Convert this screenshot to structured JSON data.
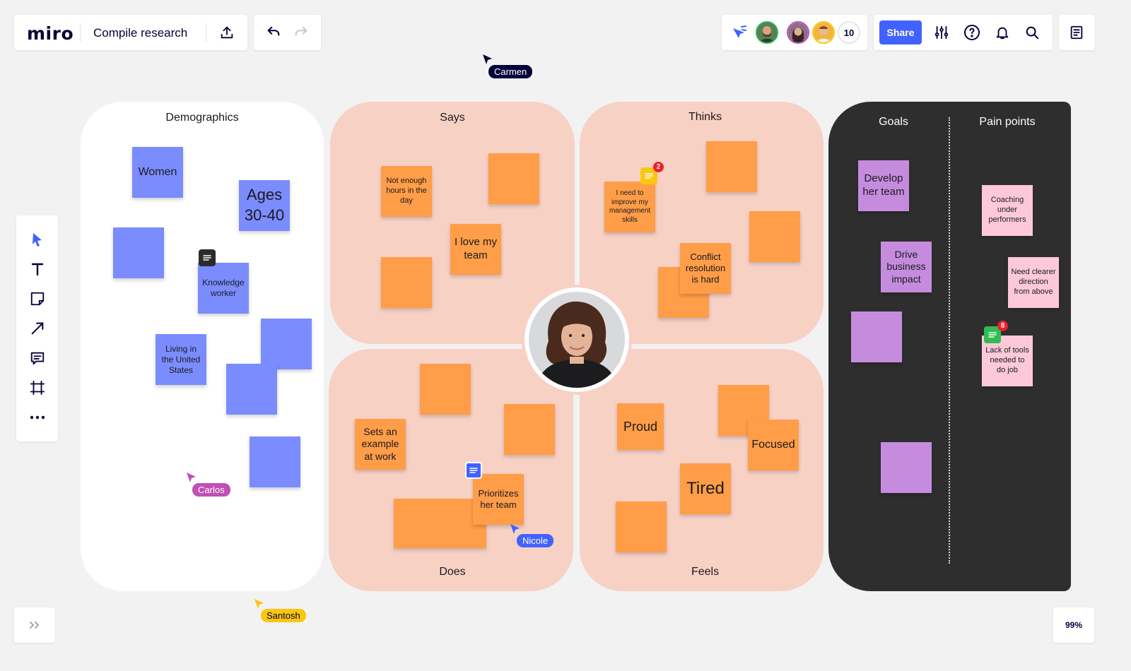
{
  "app": {
    "logo": "miro",
    "board_title": "Compile research"
  },
  "collaborators": {
    "count_label": "10"
  },
  "toolbar": {
    "share_label": "Share",
    "zoom_label": "99%"
  },
  "frames": {
    "demographics": "Demographics",
    "says": "Says",
    "thinks": "Thinks",
    "does": "Does",
    "feels": "Feels",
    "goals": "Goals",
    "pain_points": "Pain points"
  },
  "stickies": {
    "women": "Women",
    "ages": "Ages 30-40",
    "knowledge_worker": "Knowledge worker",
    "living_us": "Living in the United States",
    "not_enough_hours": "Not enough hours in the day",
    "love_team": "I love my team",
    "improve_management": "I need to improve my management skills",
    "conflict_resolution": "Conflict resolution is hard",
    "sets_example": "Sets an example at work",
    "prioritizes_team": "Prioritizes her team",
    "proud": "Proud",
    "focused": "Focused",
    "tired": "Tired",
    "develop_team": "Develop her team",
    "drive_impact": "Drive business impact",
    "coaching": "Coaching under performers",
    "clearer_direction": "Need clearer direction from above",
    "lack_tools": "Lack of tools needed to do job"
  },
  "comments": {
    "thinks_badge": "2",
    "pain_badge": "8"
  },
  "cursors": {
    "carmen": "Carmen",
    "carlos": "Carlos",
    "nicole": "Nicole",
    "santosh": "Santosh"
  },
  "colors": {
    "accent": "#4262ff",
    "blue_sticky": "#7b8cff",
    "orange_sticky": "#ff9d48",
    "purple_sticky": "#c58cde",
    "pink_sticky": "#fdc9d9",
    "frame_peach": "#f8d1c5",
    "frame_dark": "#2e2e2e"
  }
}
